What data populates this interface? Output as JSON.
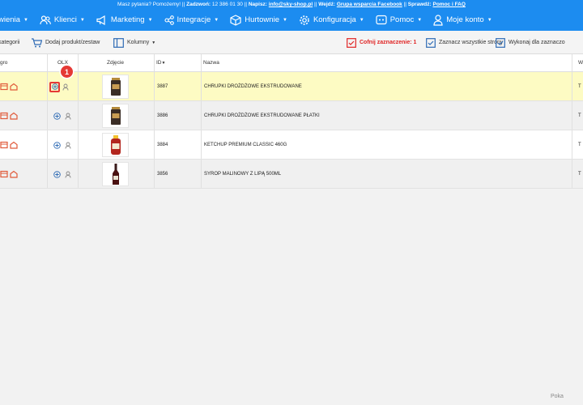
{
  "topbar": {
    "ask": "Masz pytania? Pomożemy!",
    "sep": "||",
    "call_label": "Zadzwoń:",
    "phone": "12 386 01 30",
    "write_label": "Napisz:",
    "email": "info@sky-shop.pl",
    "join_label": "Wejdź:",
    "fb_group": "Grupa wsparcia Facebook",
    "check_label": "Sprawdź:",
    "help": "Pomoc i FAQ"
  },
  "nav": {
    "items": [
      {
        "label": "wienia",
        "icon": "orders-icon"
      },
      {
        "label": "Klienci",
        "icon": "users-icon"
      },
      {
        "label": "Marketing",
        "icon": "megaphone-icon"
      },
      {
        "label": "Integracje",
        "icon": "share-icon"
      },
      {
        "label": "Hurtownie",
        "icon": "box-icon"
      },
      {
        "label": "Konfiguracja",
        "icon": "gear-icon"
      },
      {
        "label": "Pomoc",
        "icon": "help-icon"
      },
      {
        "label": "Moje konto",
        "icon": "account-icon"
      }
    ]
  },
  "toolbar": {
    "categories": "kategorii",
    "add_product": "Dodaj produkt/zestaw",
    "columns": "Kolumny",
    "undo": "Cofnij zaznaczenie: 1",
    "select_all": "Zaznacz wszystkie strony",
    "execute": "Wykonaj dla zaznaczo"
  },
  "table": {
    "headers": {
      "allegro": "gro",
      "olx": "OLX",
      "photo": "Zdjęcie",
      "id": "ID",
      "name": "Nazwa",
      "extra": "W"
    },
    "rows": [
      {
        "id": "3887",
        "name": "CHRUPKI DROŻDŻOWE EKSTRUDOWANE",
        "extra": "T"
      },
      {
        "id": "3886",
        "name": "CHRUPKI DROŻDŻOWE EKSTRUDOWANE PŁATKI",
        "extra": "T"
      },
      {
        "id": "3884",
        "name": "KETCHUP PREMIUM CLASSIC 460G",
        "extra": "T"
      },
      {
        "id": "3856",
        "name": "SYROP MALINOWY Z LIPĄ 500ML",
        "extra": "T"
      }
    ],
    "callout": "1"
  },
  "footer": {
    "text": "Poka"
  },
  "colors": {
    "brand": "#1c8cf0",
    "accent": "#e53935",
    "highlight": "#fdfbc3"
  }
}
